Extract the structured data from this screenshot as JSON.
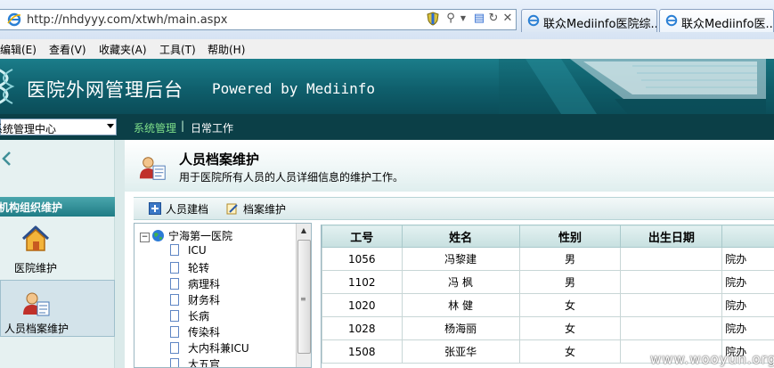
{
  "browser": {
    "url": "http://nhdyyy.com/xtwh/main.aspx",
    "tabs": [
      {
        "label": "联众Mediinfo医院综..."
      },
      {
        "label": "联众Mediinfo医..."
      }
    ],
    "menu": [
      "编辑(E)",
      "查看(V)",
      "收藏夹(A)",
      "工具(T)",
      "帮助(H)"
    ]
  },
  "header": {
    "title": "医院外网管理后台",
    "powered_by": "Powered by Mediinfo"
  },
  "nav": {
    "center_select": "系统管理中心",
    "items": [
      "系统管理",
      "|",
      "日常工作"
    ]
  },
  "sidebar": {
    "section": "机构组织维护",
    "items": [
      {
        "label": "医院维护"
      },
      {
        "label": "人员档案维护"
      }
    ]
  },
  "page": {
    "title": "人员档案维护",
    "description": "用于医院所有人员的人员详细信息的维护工作。",
    "toolbar": [
      "人员建档",
      "档案维护"
    ]
  },
  "tree": {
    "root": "宁海第一医院",
    "children": [
      "ICU",
      "轮转",
      "病理科",
      "财务科",
      "长病",
      "传染科",
      "大内科兼ICU",
      "大五官"
    ]
  },
  "grid": {
    "columns": [
      "工号",
      "姓名",
      "性别",
      "出生日期",
      ""
    ],
    "rows": [
      [
        "1056",
        "冯黎建",
        "男",
        "",
        "院办"
      ],
      [
        "1102",
        "冯 枫",
        "男",
        "",
        "院办"
      ],
      [
        "1020",
        "林 健",
        "女",
        "",
        "院办"
      ],
      [
        "1028",
        "杨海丽",
        "女",
        "",
        "院办"
      ],
      [
        "1508",
        "张亚华",
        "女",
        "",
        "院办"
      ]
    ]
  },
  "watermark": "www.wooyun.org",
  "colors": {
    "banner": "#0f5f6c",
    "nav_bar": "#0b3f47",
    "nav_active": "#7fe08a",
    "sidebar_header": "#1f7c85"
  }
}
